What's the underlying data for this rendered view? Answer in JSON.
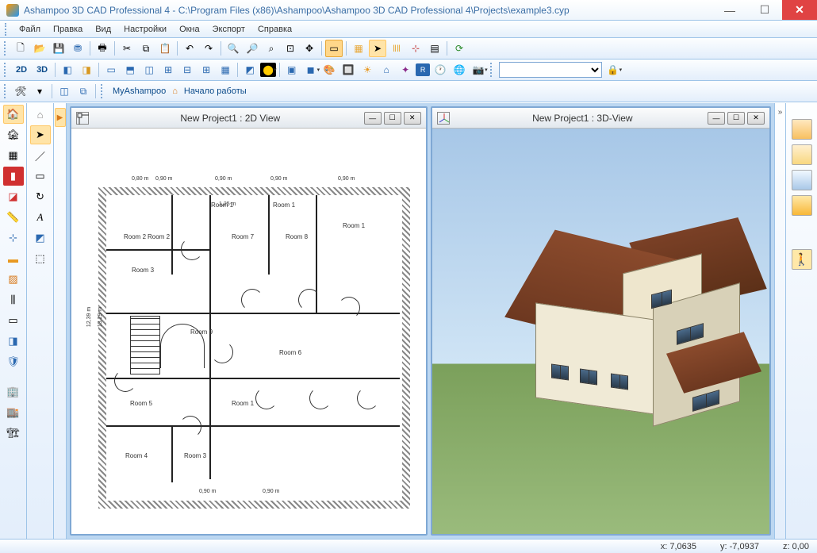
{
  "titlebar": {
    "app_name": "Ashampoo 3D CAD Professional 4",
    "separator": " - ",
    "path": "C:\\Program Files (x86)\\Ashampoo\\Ashampoo 3D CAD Professional 4\\Projects\\example3.cyp"
  },
  "menu": {
    "file": "Файл",
    "edit": "Правка",
    "view": "Вид",
    "settings": "Настройки",
    "windows": "Окна",
    "export": "Экспорт",
    "help": "Справка"
  },
  "toolbar2": {
    "btn_2d": "2D",
    "btn_3d": "3D"
  },
  "quickbar": {
    "myashampoo": "MyAshampoo",
    "getting_started": "Начало работы"
  },
  "views": {
    "view2d_title": "New Project1 : 2D View",
    "view3d_title": "New Project1 : 3D-View"
  },
  "rooms": {
    "r1": "Room 1",
    "r2": "Room 2",
    "r3": "Room 3",
    "r4": "Room 4",
    "r5": "Room 5",
    "r6": "Room 6",
    "r7": "Room 7",
    "r8": "Room 8",
    "r9": "Room 9",
    "r_small2": "Room 2",
    "r_small3": "Room 3",
    "r_inner1": "Room 1",
    "r_inner1b": "Room 1"
  },
  "dims": {
    "top1": "0,90 m",
    "top2": "0,90 m",
    "top3": "0,90 m",
    "top4": "0,90 m",
    "side1": "12,39 m",
    "side2": "13,29 m",
    "small1": "0,80 m",
    "small2": "1,25 m",
    "bottom1": "0,90 m",
    "bottom2": "0,90 m"
  },
  "status": {
    "x_label": "x:",
    "x_val": "7,0635",
    "y_label": "y:",
    "y_val": "-7,0937",
    "z_label": "z:",
    "z_val": "0,00"
  }
}
